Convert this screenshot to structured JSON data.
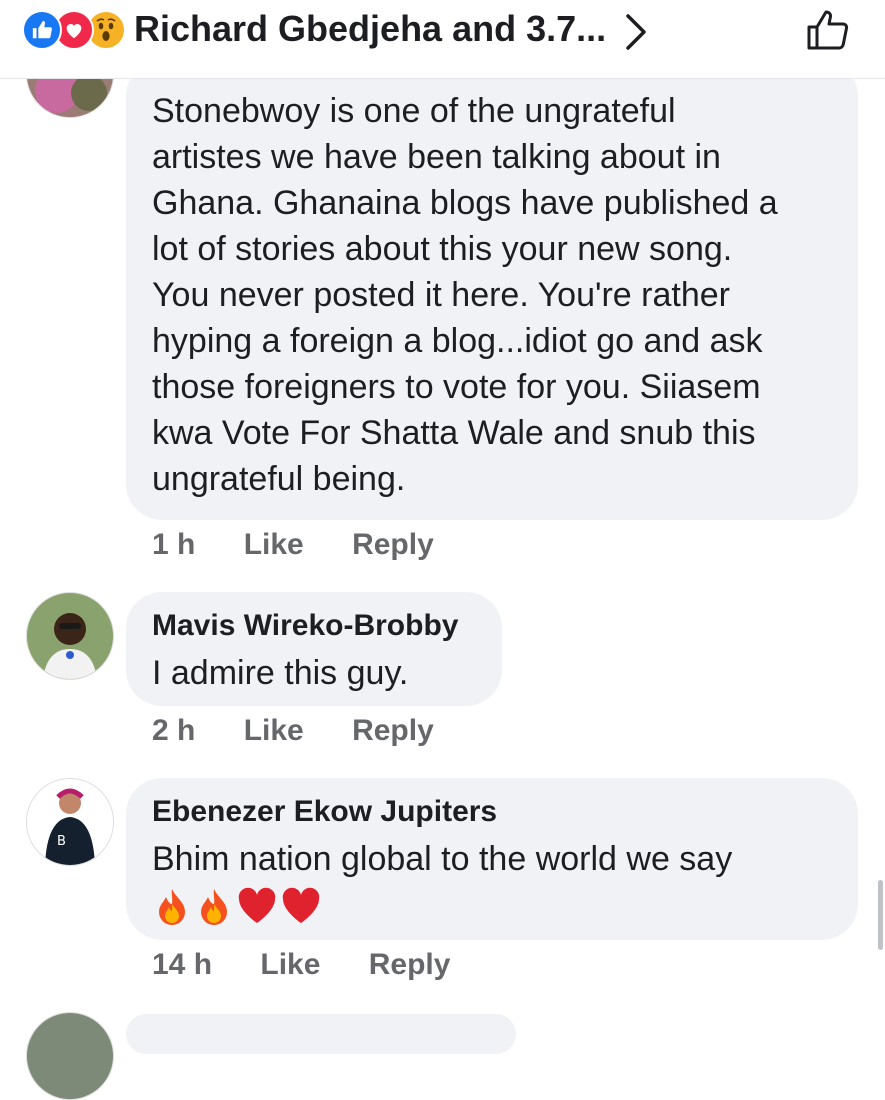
{
  "header": {
    "summary": "Richard Gbedjeha and 3.7...",
    "reaction_icons": [
      "like-icon",
      "love-icon",
      "wow-icon"
    ],
    "colors": {
      "like": "#1877f2",
      "love": "#f02849",
      "wow": "#f7b125"
    }
  },
  "comments": [
    {
      "author": "",
      "lines": [
        "Stonebwoy is one of the ungrateful",
        "artistes we have been talking about in",
        "Ghana.  Ghanaina blogs have published a",
        "lot of stories about this your new song.",
        "You never posted it here.  You're rather",
        "hyping a foreign a blog...idiot go and ask",
        "those foreigners to vote for you. Siiasem",
        "kwa Vote For Shatta Wale and snub this",
        "ungrateful being."
      ],
      "time": "1 h",
      "like_label": "Like",
      "reply_label": "Reply"
    },
    {
      "author": "Mavis Wireko-Brobby",
      "text": "I admire this guy.",
      "time": "2 h",
      "like_label": "Like",
      "reply_label": "Reply"
    },
    {
      "author": "Ebenezer Ekow Jupiters",
      "text": "Bhim nation global to the world  we say",
      "emojis": [
        "🔥",
        "🔥",
        "❤",
        "❤"
      ],
      "time": "14 h",
      "like_label": "Like",
      "reply_label": "Reply"
    }
  ]
}
